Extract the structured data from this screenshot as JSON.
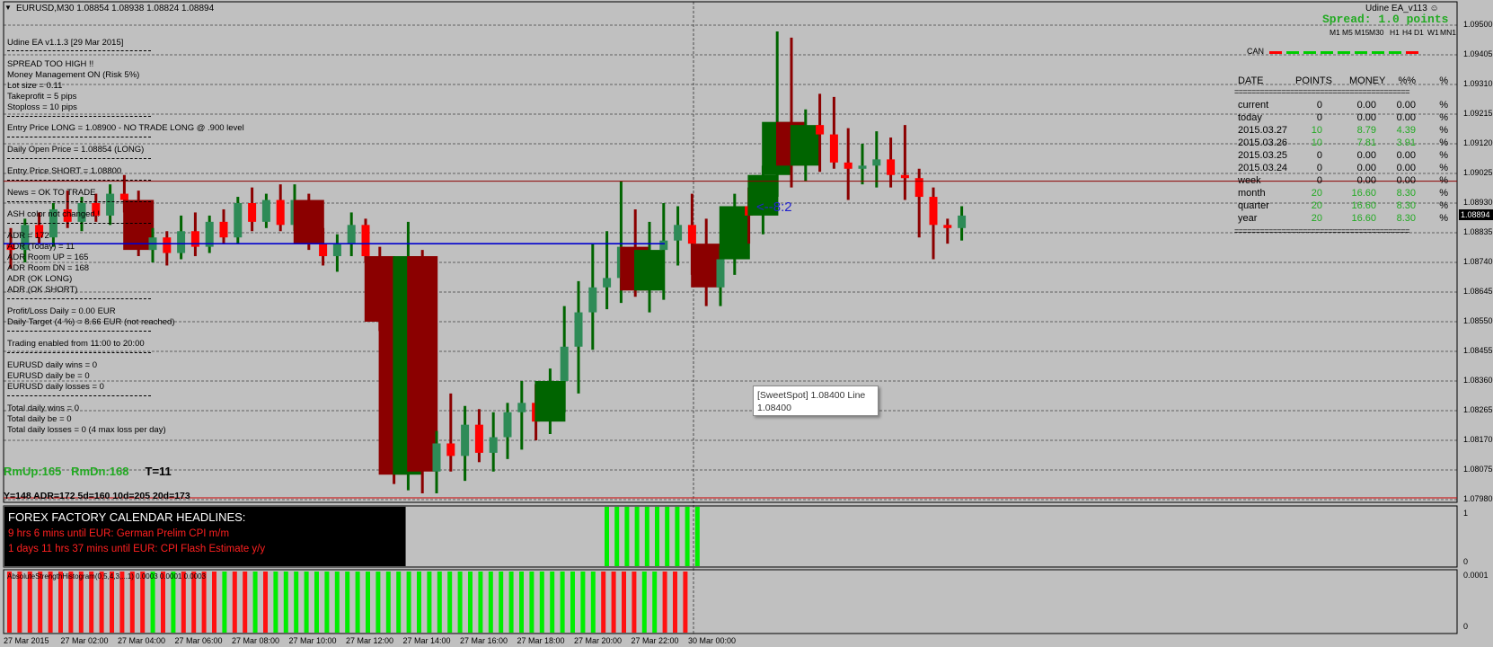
{
  "symbol_header": "EURUSD,M30  1.08854 1.08938 1.08824 1.08894",
  "ea_label": "Udine EA_v113",
  "spread_label": "Spread: 1.0 points",
  "timeframes": [
    "M1",
    "M5",
    "M15",
    "M30",
    "H1",
    "H4",
    "D1",
    "W1",
    "MN1"
  ],
  "can_label": "CAN",
  "current_price": "1.08894",
  "ratio_annotation": "<--8:2",
  "info_lines": [
    "Udine EA v1.1.3 [29 Mar 2015]",
    "SPREAD TOO HIGH !!",
    "Money Management ON (Risk 5%)",
    "Lot size = 0.11",
    "Takeprofit = 5 pips",
    "Stoploss = 10 pips",
    "Entry Price LONG = 1.08900  - NO TRADE LONG @ .900 level",
    "Daily Open Price = 1.08854 (LONG)",
    "Entry Price SHORT = 1.08800",
    "News = OK TO TRADE",
    "ASH color not changed !",
    "ADR = 172",
    "ADR (Today) = 11",
    "ADR Room UP = 165",
    "ADR Room DN = 168",
    "ADR (OK LONG)",
    "ADR (OK SHORT)",
    "Profit/Loss Daily = 0.00 EUR",
    "Daily Target (4 %) = 8.66 EUR (not reached)",
    "Trading enabled from 11:00 to 20:00",
    "EURUSD daily wins = 0",
    "EURUSD daily be = 0",
    "EURUSD daily losses = 0",
    "Total daily wins = 0",
    "Total daily be = 0",
    "Total daily losses = 0 (4 max loss per day)"
  ],
  "room_line": {
    "rmup": "RmUp:165",
    "rmdn": "RmDn:168",
    "t": "T=11"
  },
  "adr_line": "Y=148  ADR=172  5d=160  10d=205  20d=173",
  "news": {
    "title": "FOREX FACTORY CALENDAR  HEADLINES:",
    "lines": [
      "9 hrs 6 mins until EUR: German Prelim CPI m/m",
      "1 days 11 hrs 37 mins until EUR: CPI Flash Estimate y/y"
    ]
  },
  "tooltip": {
    "line1": "[SweetSpot] 1.08400 Line",
    "line2": "1.08400"
  },
  "histogram_label": "AbsoluteStrengthHistogram(0,5,4,3,...1) 0.0003 0.0001 0.0003",
  "stats": {
    "headers": [
      "DATE",
      "POINTS",
      "MONEY",
      "%%",
      "%"
    ],
    "separator": "=========================================",
    "rows": [
      {
        "date": "current",
        "points": "0",
        "money": "0.00",
        "pct": "0.00",
        "unit": "%",
        "color": "#000000"
      },
      {
        "date": "today",
        "points": "0",
        "money": "0.00",
        "pct": "0.00",
        "unit": "%",
        "color": "#000000"
      },
      {
        "date": "2015.03.27",
        "points": "10",
        "money": "8.79",
        "pct": "4.39",
        "unit": "%",
        "color": "#22aa22"
      },
      {
        "date": "2015.03.26",
        "points": "10",
        "money": "7.81",
        "pct": "3.91",
        "unit": "%",
        "color": "#22aa22"
      },
      {
        "date": "2015.03.25",
        "points": "0",
        "money": "0.00",
        "pct": "0.00",
        "unit": "%",
        "color": "#000000"
      },
      {
        "date": "2015.03.24",
        "points": "0",
        "money": "0.00",
        "pct": "0.00",
        "unit": "%",
        "color": "#000000"
      },
      {
        "date": "week",
        "points": "0",
        "money": "0.00",
        "pct": "0.00",
        "unit": "%",
        "color": "#000000"
      },
      {
        "date": "month",
        "points": "20",
        "money": "16.60",
        "pct": "8.30",
        "unit": "%",
        "color": "#22aa22"
      },
      {
        "date": "quarter",
        "points": "20",
        "money": "16.60",
        "pct": "8.30",
        "unit": "%",
        "color": "#22aa22"
      },
      {
        "date": "year",
        "points": "20",
        "money": "16.60",
        "pct": "8.30",
        "unit": "%",
        "color": "#22aa22"
      }
    ]
  },
  "price_labels": [
    "1.09500",
    "1.09405",
    "1.09310",
    "1.09215",
    "1.09120",
    "1.09025",
    "1.08930",
    "1.08835",
    "1.08740",
    "1.08645",
    "1.08550",
    "1.08455",
    "1.08360",
    "1.08265",
    "1.08170",
    "1.08075",
    "1.07980"
  ],
  "indicator_scale": {
    "top": "1",
    "bottom": "0"
  },
  "histogram_scale": {
    "top": "0.0001",
    "bottom": "0"
  },
  "time_labels": [
    "27 Mar 2015",
    "27 Mar 02:00",
    "27 Mar 04:00",
    "27 Mar 06:00",
    "27 Mar 08:00",
    "27 Mar 10:00",
    "27 Mar 12:00",
    "27 Mar 14:00",
    "27 Mar 16:00",
    "27 Mar 18:00",
    "27 Mar 20:00",
    "27 Mar 22:00",
    "30 Mar 00:00"
  ],
  "colors": {
    "bull": "#006400",
    "bear": "#8b0000",
    "bull_light": "#2e8b57",
    "bear_light": "#ff0000",
    "histo_green": "#00ee00",
    "histo_red": "#ff1111"
  },
  "chart_data": {
    "type": "candlestick",
    "symbol": "EURUSD",
    "timeframe": "M30",
    "candles": [
      {
        "o": 1.088,
        "h": 1.0885,
        "l": 1.0872,
        "c": 1.0878
      },
      {
        "o": 1.0878,
        "h": 1.0888,
        "l": 1.0874,
        "c": 1.0886
      },
      {
        "o": 1.0886,
        "h": 1.089,
        "l": 1.088,
        "c": 1.0882
      },
      {
        "o": 1.0882,
        "h": 1.0893,
        "l": 1.0879,
        "c": 1.0891
      },
      {
        "o": 1.0891,
        "h": 1.0897,
        "l": 1.0885,
        "c": 1.0887
      },
      {
        "o": 1.0887,
        "h": 1.0895,
        "l": 1.0884,
        "c": 1.0893
      },
      {
        "o": 1.0893,
        "h": 1.0896,
        "l": 1.0887,
        "c": 1.0889
      },
      {
        "o": 1.0889,
        "h": 1.0899,
        "l": 1.0886,
        "c": 1.0896
      },
      {
        "o": 1.0896,
        "h": 1.0902,
        "l": 1.089,
        "c": 1.0894
      },
      {
        "o": 1.0894,
        "h": 1.0897,
        "l": 1.0876,
        "c": 1.0878
      },
      {
        "o": 1.0878,
        "h": 1.0885,
        "l": 1.0874,
        "c": 1.0882
      },
      {
        "o": 1.0882,
        "h": 1.0884,
        "l": 1.0873,
        "c": 1.0877
      },
      {
        "o": 1.0877,
        "h": 1.0889,
        "l": 1.0875,
        "c": 1.0884
      },
      {
        "o": 1.0884,
        "h": 1.089,
        "l": 1.0876,
        "c": 1.0879
      },
      {
        "o": 1.0879,
        "h": 1.0889,
        "l": 1.0877,
        "c": 1.0887
      },
      {
        "o": 1.0887,
        "h": 1.0891,
        "l": 1.088,
        "c": 1.0882
      },
      {
        "o": 1.0882,
        "h": 1.0895,
        "l": 1.088,
        "c": 1.0893
      },
      {
        "o": 1.0893,
        "h": 1.0898,
        "l": 1.0884,
        "c": 1.0887
      },
      {
        "o": 1.0887,
        "h": 1.0896,
        "l": 1.0885,
        "c": 1.0894
      },
      {
        "o": 1.0894,
        "h": 1.0899,
        "l": 1.0884,
        "c": 1.0886
      },
      {
        "o": 1.0886,
        "h": 1.0899,
        "l": 1.0884,
        "c": 1.0894
      },
      {
        "o": 1.0894,
        "h": 1.0896,
        "l": 1.0878,
        "c": 1.088
      },
      {
        "o": 1.088,
        "h": 1.0885,
        "l": 1.0873,
        "c": 1.0876
      },
      {
        "o": 1.0876,
        "h": 1.0883,
        "l": 1.0871,
        "c": 1.088
      },
      {
        "o": 1.088,
        "h": 1.089,
        "l": 1.0876,
        "c": 1.0886
      },
      {
        "o": 1.0886,
        "h": 1.0888,
        "l": 1.0874,
        "c": 1.0876
      },
      {
        "o": 1.0876,
        "h": 1.0879,
        "l": 1.0852,
        "c": 1.0855
      },
      {
        "o": 1.0855,
        "h": 1.086,
        "l": 1.0803,
        "c": 1.0806
      },
      {
        "o": 1.0806,
        "h": 1.0887,
        "l": 1.0801,
        "c": 1.0876
      },
      {
        "o": 1.0876,
        "h": 1.0878,
        "l": 1.08,
        "c": 1.0807
      },
      {
        "o": 1.0807,
        "h": 1.082,
        "l": 1.08,
        "c": 1.0816
      },
      {
        "o": 1.0816,
        "h": 1.0832,
        "l": 1.0807,
        "c": 1.0812
      },
      {
        "o": 1.0812,
        "h": 1.0828,
        "l": 1.0804,
        "c": 1.0822
      },
      {
        "o": 1.0822,
        "h": 1.0827,
        "l": 1.081,
        "c": 1.0813
      },
      {
        "o": 1.0813,
        "h": 1.0826,
        "l": 1.0807,
        "c": 1.0818
      },
      {
        "o": 1.0818,
        "h": 1.0829,
        "l": 1.0811,
        "c": 1.0826
      },
      {
        "o": 1.0826,
        "h": 1.0836,
        "l": 1.0814,
        "c": 1.0829
      },
      {
        "o": 1.0829,
        "h": 1.0835,
        "l": 1.0817,
        "c": 1.0823
      },
      {
        "o": 1.0823,
        "h": 1.084,
        "l": 1.0819,
        "c": 1.0836
      },
      {
        "o": 1.0836,
        "h": 1.086,
        "l": 1.0826,
        "c": 1.0847
      },
      {
        "o": 1.0847,
        "h": 1.0868,
        "l": 1.0832,
        "c": 1.0858
      },
      {
        "o": 1.0858,
        "h": 1.088,
        "l": 1.0846,
        "c": 1.0866
      },
      {
        "o": 1.0866,
        "h": 1.0884,
        "l": 1.0859,
        "c": 1.0869
      },
      {
        "o": 1.0869,
        "h": 1.09,
        "l": 1.0861,
        "c": 1.0879
      },
      {
        "o": 1.0879,
        "h": 1.0891,
        "l": 1.0863,
        "c": 1.0865
      },
      {
        "o": 1.0865,
        "h": 1.0887,
        "l": 1.0858,
        "c": 1.0878
      },
      {
        "o": 1.0878,
        "h": 1.0893,
        "l": 1.0862,
        "c": 1.0881
      },
      {
        "o": 1.0881,
        "h": 1.0892,
        "l": 1.0873,
        "c": 1.0886
      },
      {
        "o": 1.0886,
        "h": 1.0896,
        "l": 1.087,
        "c": 1.088
      },
      {
        "o": 1.088,
        "h": 1.0888,
        "l": 1.086,
        "c": 1.0866
      },
      {
        "o": 1.0866,
        "h": 1.0879,
        "l": 1.086,
        "c": 1.0875
      },
      {
        "o": 1.0875,
        "h": 1.0896,
        "l": 1.087,
        "c": 1.0892
      },
      {
        "o": 1.0892,
        "h": 1.0898,
        "l": 1.088,
        "c": 1.0889
      },
      {
        "o": 1.0889,
        "h": 1.0905,
        "l": 1.0883,
        "c": 1.0902
      },
      {
        "o": 1.0902,
        "h": 1.0948,
        "l": 1.0895,
        "c": 1.0919
      },
      {
        "o": 1.0919,
        "h": 1.0946,
        "l": 1.0898,
        "c": 1.0905
      },
      {
        "o": 1.0905,
        "h": 1.0923,
        "l": 1.09,
        "c": 1.0918
      },
      {
        "o": 1.0918,
        "h": 1.0928,
        "l": 1.0903,
        "c": 1.0915
      },
      {
        "o": 1.0915,
        "h": 1.0927,
        "l": 1.0904,
        "c": 1.0906
      },
      {
        "o": 1.0906,
        "h": 1.0917,
        "l": 1.0894,
        "c": 1.0904
      },
      {
        "o": 1.0904,
        "h": 1.0912,
        "l": 1.0899,
        "c": 1.0905
      },
      {
        "o": 1.0905,
        "h": 1.0916,
        "l": 1.0898,
        "c": 1.0907
      },
      {
        "o": 1.0907,
        "h": 1.0914,
        "l": 1.0898,
        "c": 1.0902
      },
      {
        "o": 1.0902,
        "h": 1.0918,
        "l": 1.0894,
        "c": 1.0901
      },
      {
        "o": 1.0901,
        "h": 1.0904,
        "l": 1.0882,
        "c": 1.0895
      },
      {
        "o": 1.0895,
        "h": 1.0898,
        "l": 1.0875,
        "c": 1.0886
      },
      {
        "o": 1.0886,
        "h": 1.0888,
        "l": 1.088,
        "c": 1.0885
      },
      {
        "o": 1.0885,
        "h": 1.0892,
        "l": 1.0881,
        "c": 1.0889
      }
    ]
  }
}
